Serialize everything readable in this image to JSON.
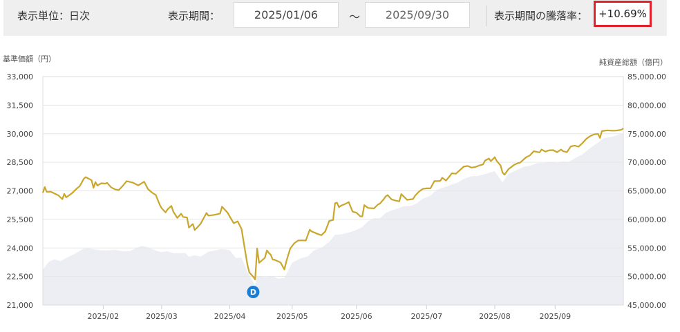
{
  "header": {
    "unit_label": "表示単位：日次",
    "period_label": "表示期間：",
    "start_date": "2025/01/06",
    "range_sep": "〜",
    "end_date": "2025/09/30",
    "change_label": "表示期間の騰落率：",
    "change_value": "+10.69%",
    "highlight_color": "#e0202a"
  },
  "chart_data": {
    "type": "line",
    "left_axis_title": "基準価額（円）",
    "right_axis_title": "純資産総額（億円）",
    "x_ticks": [
      "2025/02",
      "2025/03",
      "2025/04",
      "2025/05",
      "2025/06",
      "2025/07",
      "2025/08",
      "2025/09"
    ],
    "y_left_ticks": [
      "33,000",
      "31,500",
      "30,000",
      "28,500",
      "27,000",
      "25,500",
      "24,000",
      "22,500",
      "21,000"
    ],
    "y_right_ticks": [
      "85,000.00",
      "80,000.00",
      "75,000.00",
      "70,000.00",
      "65,000.00",
      "60,000.00",
      "55,000.00",
      "50,000.00",
      "45,000.00"
    ],
    "ylim_left": [
      21000,
      33000
    ],
    "ylim_right": [
      45000,
      85000
    ],
    "xlim": [
      "2025-01-06",
      "2025-09-30"
    ],
    "marker": {
      "label": "D",
      "date": "2025-04-24",
      "color": "#1a7fd4"
    },
    "colors": {
      "nav_line": "#c9a62c",
      "aum_area": "#eceef3",
      "grid": "#e6e6e6"
    },
    "series": [
      {
        "kind": "line",
        "axis": "left",
        "points": [
          [
            "2025-01-06",
            26900
          ],
          [
            "2025-01-07",
            27200
          ],
          [
            "2025-01-08",
            26950
          ],
          [
            "2025-01-10",
            26960
          ],
          [
            "2025-01-14",
            26760
          ],
          [
            "2025-01-16",
            26560
          ],
          [
            "2025-01-17",
            26840
          ],
          [
            "2025-01-18",
            26660
          ],
          [
            "2025-01-21",
            26880
          ],
          [
            "2025-01-23",
            27080
          ],
          [
            "2025-01-25",
            27260
          ],
          [
            "2025-01-27",
            27630
          ],
          [
            "2025-01-28",
            27720
          ],
          [
            "2025-01-31",
            27560
          ],
          [
            "2025-02-01",
            27160
          ],
          [
            "2025-02-02",
            27460
          ],
          [
            "2025-02-03",
            27280
          ],
          [
            "2025-02-05",
            27400
          ],
          [
            "2025-02-07",
            27380
          ],
          [
            "2025-02-08",
            27420
          ],
          [
            "2025-02-10",
            27190
          ],
          [
            "2025-02-12",
            27080
          ],
          [
            "2025-02-14",
            27040
          ],
          [
            "2025-02-16",
            27260
          ],
          [
            "2025-02-18",
            27510
          ],
          [
            "2025-02-21",
            27440
          ],
          [
            "2025-02-24",
            27290
          ],
          [
            "2025-02-27",
            27480
          ],
          [
            "2025-03-01",
            27090
          ],
          [
            "2025-03-03",
            26910
          ],
          [
            "2025-03-05",
            26780
          ],
          [
            "2025-03-07",
            26270
          ],
          [
            "2025-03-08",
            26090
          ],
          [
            "2025-03-10",
            25870
          ],
          [
            "2025-03-11",
            26030
          ],
          [
            "2025-03-13",
            26210
          ],
          [
            "2025-03-14",
            25900
          ],
          [
            "2025-03-16",
            25580
          ],
          [
            "2025-03-18",
            25800
          ],
          [
            "2025-03-19",
            25630
          ],
          [
            "2025-03-21",
            25600
          ],
          [
            "2025-03-22",
            25070
          ],
          [
            "2025-03-24",
            25260
          ],
          [
            "2025-03-25",
            24940
          ],
          [
            "2025-03-28",
            25270
          ],
          [
            "2025-03-31",
            25840
          ],
          [
            "2025-04-01",
            25700
          ],
          [
            "2025-04-04",
            25740
          ],
          [
            "2025-04-07",
            25810
          ],
          [
            "2025-04-08",
            26170
          ],
          [
            "2025-04-11",
            25830
          ],
          [
            "2025-04-12",
            25640
          ],
          [
            "2025-04-14",
            25300
          ],
          [
            "2025-04-16",
            25400
          ],
          [
            "2025-04-18",
            25000
          ],
          [
            "2025-04-21",
            23120
          ],
          [
            "2025-04-22",
            22710
          ],
          [
            "2025-04-24",
            22490
          ],
          [
            "2025-04-25",
            22340
          ],
          [
            "2025-04-26",
            23980
          ],
          [
            "2025-04-27",
            23220
          ],
          [
            "2025-04-30",
            23480
          ],
          [
            "2025-05-01",
            23870
          ],
          [
            "2025-05-02",
            23740
          ],
          [
            "2025-05-03",
            23640
          ],
          [
            "2025-05-04",
            23390
          ],
          [
            "2025-05-05",
            23380
          ],
          [
            "2025-05-06",
            23330
          ],
          [
            "2025-05-08",
            23240
          ],
          [
            "2025-05-10",
            22870
          ],
          [
            "2025-05-11",
            23290
          ],
          [
            "2025-05-13",
            23970
          ],
          [
            "2025-05-15",
            24240
          ],
          [
            "2025-05-17",
            24390
          ],
          [
            "2025-05-19",
            24400
          ],
          [
            "2025-05-21",
            24390
          ],
          [
            "2025-05-23",
            24960
          ],
          [
            "2025-05-24",
            24870
          ],
          [
            "2025-05-27",
            24740
          ],
          [
            "2025-05-29",
            24670
          ],
          [
            "2025-05-31",
            24870
          ],
          [
            "2025-06-02",
            25420
          ],
          [
            "2025-06-04",
            25470
          ],
          [
            "2025-06-05",
            26350
          ],
          [
            "2025-06-06",
            26380
          ],
          [
            "2025-06-07",
            26140
          ],
          [
            "2025-06-08",
            26220
          ],
          [
            "2025-06-10",
            26300
          ],
          [
            "2025-06-12",
            26410
          ],
          [
            "2025-06-14",
            25910
          ],
          [
            "2025-06-16",
            25850
          ],
          [
            "2025-06-18",
            25660
          ],
          [
            "2025-06-19",
            25660
          ],
          [
            "2025-06-20",
            26250
          ],
          [
            "2025-06-22",
            26100
          ],
          [
            "2025-06-25",
            26080
          ],
          [
            "2025-06-27",
            26280
          ],
          [
            "2025-06-28",
            26330
          ],
          [
            "2025-06-30",
            26560
          ],
          [
            "2025-07-01",
            26710
          ],
          [
            "2025-07-02",
            26780
          ],
          [
            "2025-07-04",
            26550
          ],
          [
            "2025-07-06",
            26490
          ],
          [
            "2025-07-08",
            26450
          ],
          [
            "2025-07-09",
            26830
          ],
          [
            "2025-07-12",
            26530
          ],
          [
            "2025-07-15",
            26570
          ],
          [
            "2025-07-16",
            26730
          ],
          [
            "2025-07-18",
            26950
          ],
          [
            "2025-07-20",
            27100
          ],
          [
            "2025-07-22",
            27130
          ],
          [
            "2025-07-24",
            27130
          ],
          [
            "2025-07-26",
            27510
          ],
          [
            "2025-07-29",
            27520
          ],
          [
            "2025-07-30",
            27690
          ],
          [
            "2025-08-01",
            27540
          ],
          [
            "2025-08-04",
            27920
          ],
          [
            "2025-08-06",
            27900
          ],
          [
            "2025-08-08",
            28080
          ],
          [
            "2025-08-10",
            28270
          ],
          [
            "2025-08-12",
            28310
          ],
          [
            "2025-08-14",
            28220
          ],
          [
            "2025-08-16",
            28250
          ],
          [
            "2025-08-18",
            28330
          ],
          [
            "2025-08-20",
            28390
          ],
          [
            "2025-08-21",
            28590
          ],
          [
            "2025-08-23",
            28700
          ],
          [
            "2025-08-24",
            28560
          ],
          [
            "2025-08-26",
            28770
          ],
          [
            "2025-08-27",
            28570
          ],
          [
            "2025-08-29",
            28330
          ],
          [
            "2025-08-30",
            27960
          ],
          [
            "2025-08-31",
            27850
          ],
          [
            "2025-09-02",
            28140
          ],
          [
            "2025-09-05",
            28370
          ],
          [
            "2025-09-07",
            28460
          ],
          [
            "2025-09-08",
            28480
          ],
          [
            "2025-09-09",
            28570
          ],
          [
            "2025-09-11",
            28760
          ],
          [
            "2025-09-13",
            28860
          ],
          [
            "2025-09-15",
            29080
          ],
          [
            "2025-09-18",
            29020
          ],
          [
            "2025-09-19",
            29170
          ],
          [
            "2025-09-21",
            29060
          ],
          [
            "2025-09-23",
            29130
          ],
          [
            "2025-09-25",
            29140
          ],
          [
            "2025-09-27",
            29030
          ],
          [
            "2025-09-29",
            29170
          ],
          [
            "2025-09-30",
            29090
          ],
          [
            "2025-10-02",
            29030
          ],
          [
            "2025-10-04",
            29330
          ],
          [
            "2025-10-06",
            29380
          ],
          [
            "2025-10-08",
            29320
          ],
          [
            "2025-10-10",
            29510
          ],
          [
            "2025-10-12",
            29730
          ],
          [
            "2025-10-14",
            29880
          ],
          [
            "2025-10-16",
            29970
          ],
          [
            "2025-10-18",
            29990
          ],
          [
            "2025-10-19",
            29780
          ],
          [
            "2025-10-20",
            30140
          ],
          [
            "2025-10-23",
            30180
          ],
          [
            "2025-10-25",
            30160
          ],
          [
            "2025-10-27",
            30160
          ],
          [
            "2025-10-30",
            30210
          ],
          [
            "2025-10-31",
            30280
          ]
        ]
      },
      {
        "kind": "area",
        "axis": "right",
        "points": [
          [
            "2025-01-06",
            51200
          ],
          [
            "2025-01-09",
            52560
          ],
          [
            "2025-01-12",
            53020
          ],
          [
            "2025-01-15",
            52690
          ],
          [
            "2025-01-18",
            53240
          ],
          [
            "2025-01-21",
            53730
          ],
          [
            "2025-01-24",
            54300
          ],
          [
            "2025-01-27",
            54890
          ],
          [
            "2025-01-30",
            54900
          ],
          [
            "2025-02-02",
            54730
          ],
          [
            "2025-02-05",
            54580
          ],
          [
            "2025-02-08",
            54560
          ],
          [
            "2025-02-12",
            54680
          ],
          [
            "2025-02-16",
            54420
          ],
          [
            "2025-02-20",
            54470
          ],
          [
            "2025-02-23",
            55000
          ],
          [
            "2025-02-26",
            55360
          ],
          [
            "2025-03-01",
            55080
          ],
          [
            "2025-03-05",
            54540
          ],
          [
            "2025-03-08",
            54270
          ],
          [
            "2025-03-11",
            54420
          ],
          [
            "2025-03-14",
            54080
          ],
          [
            "2025-03-18",
            54080
          ],
          [
            "2025-03-20",
            54120
          ],
          [
            "2025-03-22",
            53450
          ],
          [
            "2025-03-25",
            53710
          ],
          [
            "2025-03-28",
            53500
          ],
          [
            "2025-04-01",
            54330
          ],
          [
            "2025-04-05",
            54620
          ],
          [
            "2025-04-08",
            54810
          ],
          [
            "2025-04-12",
            54590
          ],
          [
            "2025-04-15",
            53270
          ],
          [
            "2025-04-18",
            53300
          ],
          [
            "2025-04-21",
            50840
          ],
          [
            "2025-04-25",
            48420
          ],
          [
            "2025-04-26",
            50150
          ],
          [
            "2025-04-30",
            49880
          ],
          [
            "2025-05-04",
            50050
          ],
          [
            "2025-05-07",
            49610
          ],
          [
            "2025-05-10",
            49760
          ],
          [
            "2025-05-14",
            52420
          ],
          [
            "2025-05-18",
            53140
          ],
          [
            "2025-05-22",
            53510
          ],
          [
            "2025-05-25",
            54510
          ],
          [
            "2025-05-29",
            55030
          ],
          [
            "2025-06-02",
            56070
          ],
          [
            "2025-06-05",
            57310
          ],
          [
            "2025-06-08",
            57370
          ],
          [
            "2025-06-12",
            57700
          ],
          [
            "2025-06-15",
            58010
          ],
          [
            "2025-06-19",
            58660
          ],
          [
            "2025-06-22",
            59690
          ],
          [
            "2025-06-25",
            60190
          ],
          [
            "2025-06-28",
            60180
          ],
          [
            "2025-07-01",
            61130
          ],
          [
            "2025-07-04",
            61580
          ],
          [
            "2025-07-07",
            61890
          ],
          [
            "2025-07-10",
            62280
          ],
          [
            "2025-07-14",
            62350
          ],
          [
            "2025-07-17",
            62820
          ],
          [
            "2025-07-20",
            63620
          ],
          [
            "2025-07-24",
            64150
          ],
          [
            "2025-07-27",
            65180
          ],
          [
            "2025-07-31",
            65600
          ],
          [
            "2025-08-04",
            66110
          ],
          [
            "2025-08-07",
            66450
          ],
          [
            "2025-08-10",
            67080
          ],
          [
            "2025-08-14",
            67560
          ],
          [
            "2025-08-17",
            67590
          ],
          [
            "2025-08-20",
            67830
          ],
          [
            "2025-08-23",
            68150
          ],
          [
            "2025-08-26",
            68430
          ],
          [
            "2025-08-30",
            66500
          ],
          [
            "2025-09-02",
            67950
          ],
          [
            "2025-09-06",
            68610
          ],
          [
            "2025-09-10",
            69240
          ],
          [
            "2025-09-13",
            69380
          ],
          [
            "2025-09-17",
            69870
          ],
          [
            "2025-09-20",
            69870
          ],
          [
            "2025-09-24",
            70050
          ],
          [
            "2025-09-27",
            69880
          ],
          [
            "2025-09-30",
            70140
          ],
          [
            "2025-10-03",
            70060
          ],
          [
            "2025-10-07",
            70870
          ],
          [
            "2025-10-10",
            71390
          ],
          [
            "2025-10-14",
            72490
          ],
          [
            "2025-10-17",
            73210
          ],
          [
            "2025-10-21",
            74220
          ],
          [
            "2025-10-25",
            74480
          ],
          [
            "2025-10-28",
            74770
          ],
          [
            "2025-10-31",
            75070
          ]
        ]
      }
    ]
  }
}
